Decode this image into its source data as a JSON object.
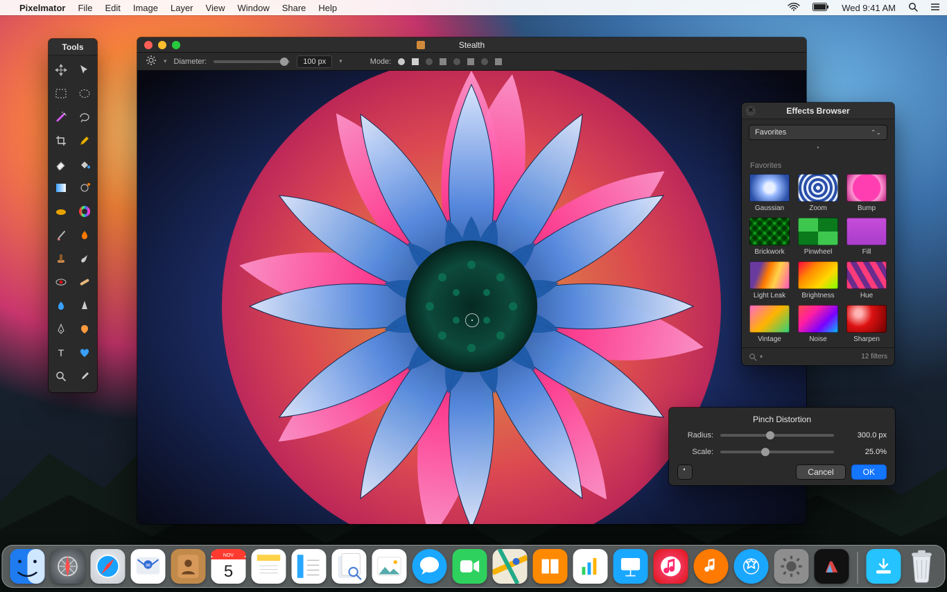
{
  "menubar": {
    "app": "Pixelmator",
    "items": [
      "File",
      "Edit",
      "Image",
      "Layer",
      "View",
      "Window",
      "Share",
      "Help"
    ],
    "clock": "Wed 9:41 AM"
  },
  "tools": {
    "title": "Tools",
    "items": [
      "move",
      "arrow-select",
      "rect-marquee",
      "ellipse-marquee",
      "magic-wand",
      "lasso",
      "crop",
      "pencil",
      "eraser",
      "paint-bucket",
      "gradient",
      "hand",
      "sponge",
      "color-wheel",
      "brush",
      "burn",
      "clone",
      "smudge",
      "red-eye",
      "heal",
      "blur",
      "sharpen",
      "pen",
      "shape",
      "type",
      "heart-shape",
      "zoom",
      "eyedropper"
    ]
  },
  "document": {
    "title": "Stealth",
    "options": {
      "diameter_label": "Diameter:",
      "diameter_value": "100 px",
      "mode_label": "Mode:"
    }
  },
  "effects": {
    "title": "Effects Browser",
    "dropdown": "Favorites",
    "section": "Favorites",
    "items": [
      "Gaussian",
      "Zoom",
      "Bump",
      "Brickwork",
      "Pinwheel",
      "Fill",
      "Light Leak",
      "Brightness",
      "Hue",
      "Vintage",
      "Noise",
      "Sharpen"
    ],
    "count": "12 filters"
  },
  "adjust": {
    "title": "Pinch Distortion",
    "radius_label": "Radius:",
    "radius_value": "300.0 px",
    "scale_label": "Scale:",
    "scale_value": "25.0%",
    "cancel": "Cancel",
    "ok": "OK"
  },
  "dock": {
    "apps": [
      "finder",
      "launchpad",
      "safari",
      "mail",
      "contacts",
      "calendar",
      "notes",
      "reminders",
      "preview",
      "photos",
      "messages",
      "facetime",
      "maps",
      "ibooks",
      "numbers",
      "keynote",
      "itunes",
      "itunes-store",
      "appstore",
      "system-preferences",
      "pixelmator"
    ],
    "calendar_day": "5",
    "calendar_month": "NOV"
  }
}
